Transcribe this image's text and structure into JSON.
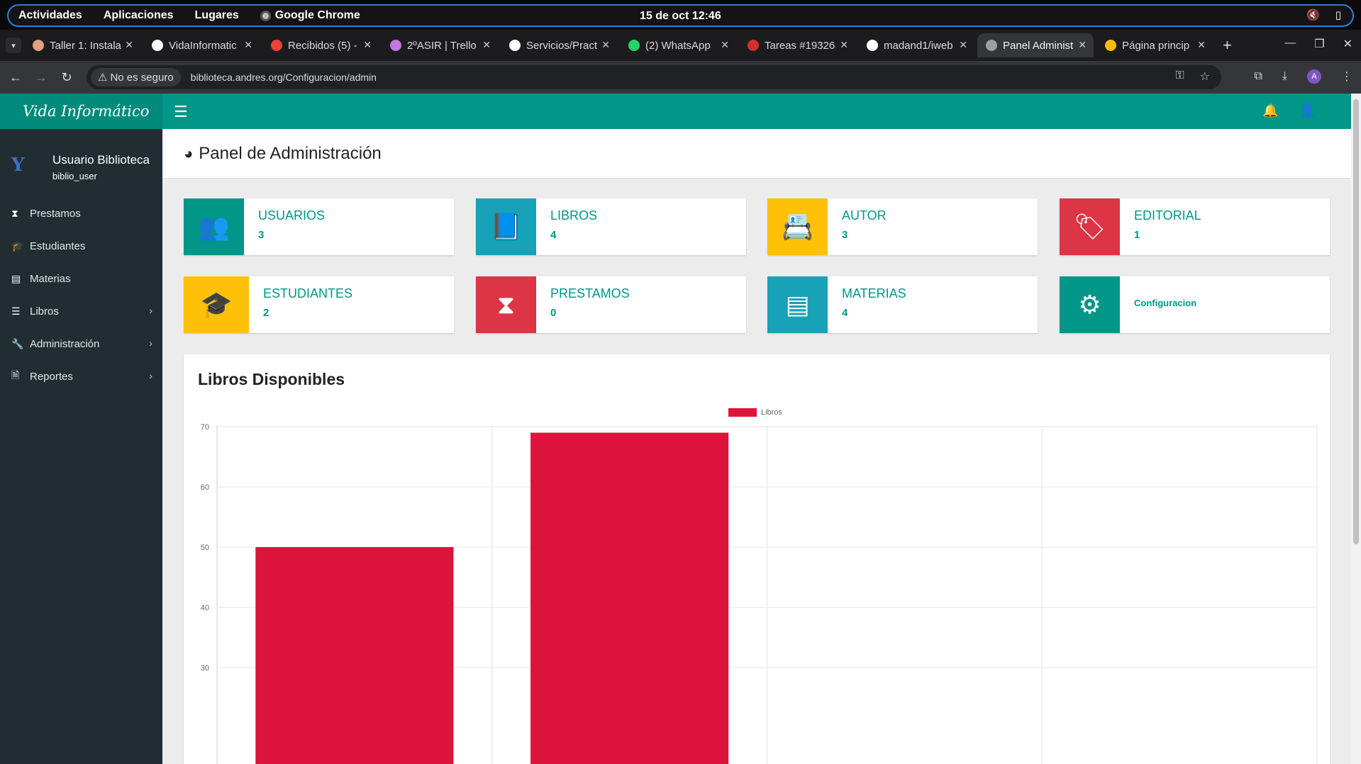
{
  "gnome": {
    "activities": "Actividades",
    "applications": "Aplicaciones",
    "places": "Lugares",
    "app_name": "Google Chrome",
    "clock": "15 de oct  12:46"
  },
  "tabs": [
    {
      "title": "Taller 1: Instala",
      "color": "#e0a080"
    },
    {
      "title": "VidaInformatic",
      "color": "#ffffff"
    },
    {
      "title": "Recibidos (5) -",
      "color": "#ea4335"
    },
    {
      "title": "2ºASIR | Trello",
      "color": "#c377e0"
    },
    {
      "title": "Servicios/Pract",
      "color": "#ffffff"
    },
    {
      "title": "(2) WhatsApp",
      "color": "#25d366"
    },
    {
      "title": "Tareas #19326",
      "color": "#d32f2f"
    },
    {
      "title": "madand1/iweb",
      "color": "#ffffff"
    },
    {
      "title": "Panel Administ",
      "color": "#9aa0a6"
    },
    {
      "title": "Página princip",
      "color": "#fbbc04"
    }
  ],
  "addressbar": {
    "not_secure": "No es seguro",
    "url": "biblioteca.andres.org/Configuracion/admin",
    "avatar_letter": "A"
  },
  "sidebar": {
    "brand": "Vida Informático",
    "user_logo": "Y",
    "user_name": "Usuario Biblioteca",
    "user_login": "biblio_user",
    "items": [
      {
        "label": "Prestamos",
        "icon": "hourglass-icon"
      },
      {
        "label": "Estudiantes",
        "icon": "graduation-cap-icon"
      },
      {
        "label": "Materias",
        "icon": "list-alt-icon"
      },
      {
        "label": "Libros",
        "icon": "list-icon"
      },
      {
        "label": "Administración",
        "icon": "wrench-icon"
      },
      {
        "label": "Reportes",
        "icon": "file-icon"
      }
    ]
  },
  "main": {
    "page_title": "Panel de Administración",
    "boxes": [
      {
        "label": "USUARIOS",
        "value": "3",
        "color": "#009688"
      },
      {
        "label": "LIBROS",
        "value": "4",
        "color": "#17a2b8"
      },
      {
        "label": "AUTOR",
        "value": "3",
        "color": "#ffc107"
      },
      {
        "label": "EDITORIAL",
        "value": "1",
        "color": "#dc3545"
      },
      {
        "label": "ESTUDIANTES",
        "value": "2",
        "color": "#ffc107"
      },
      {
        "label": "PRESTAMOS",
        "value": "0",
        "color": "#dc3545"
      },
      {
        "label": "MATERIAS",
        "value": "4",
        "color": "#17a2b8"
      },
      {
        "label": "Configuracion",
        "value": "",
        "color": "#009688"
      }
    ]
  },
  "chart_data": {
    "type": "bar",
    "title": "Libros Disponibles",
    "series": [
      {
        "name": "Libros",
        "values": [
          50,
          69,
          null,
          null
        ],
        "color": "#dc143c"
      }
    ],
    "categories": [
      "",
      "",
      "",
      ""
    ],
    "y_ticks": [
      "70",
      "60",
      "50",
      "40",
      "30"
    ],
    "ylim_visible": [
      30,
      70
    ],
    "grid": true,
    "legend": "top-center"
  }
}
